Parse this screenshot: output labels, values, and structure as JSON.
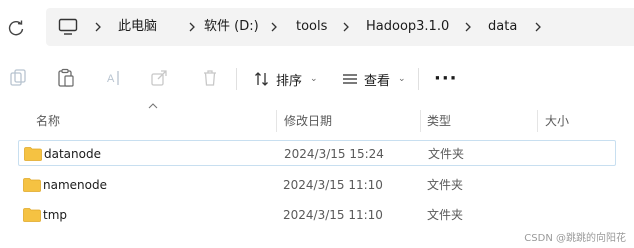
{
  "address": {
    "breadcrumbs": [
      "此电脑",
      "软件 (D:)",
      "tools",
      "Hadoop3.1.0",
      "data"
    ]
  },
  "toolbar": {
    "sort_label": "排序",
    "view_label": "查看",
    "more_label": "···"
  },
  "columns": {
    "name": "名称",
    "modified": "修改日期",
    "type": "类型",
    "size": "大小"
  },
  "files": [
    {
      "name": "datanode",
      "modified": "2024/3/15 15:24",
      "type": "文件夹",
      "size": ""
    },
    {
      "name": "namenode",
      "modified": "2024/3/15 11:10",
      "type": "文件夹",
      "size": ""
    },
    {
      "name": "tmp",
      "modified": "2024/3/15 11:10",
      "type": "文件夹",
      "size": ""
    }
  ],
  "watermark": "CSDN @跳跳的向阳花",
  "colors": {
    "folder": "#f5c242",
    "selected_border": "#c8dff0",
    "address_bg": "#f3f3f3"
  }
}
